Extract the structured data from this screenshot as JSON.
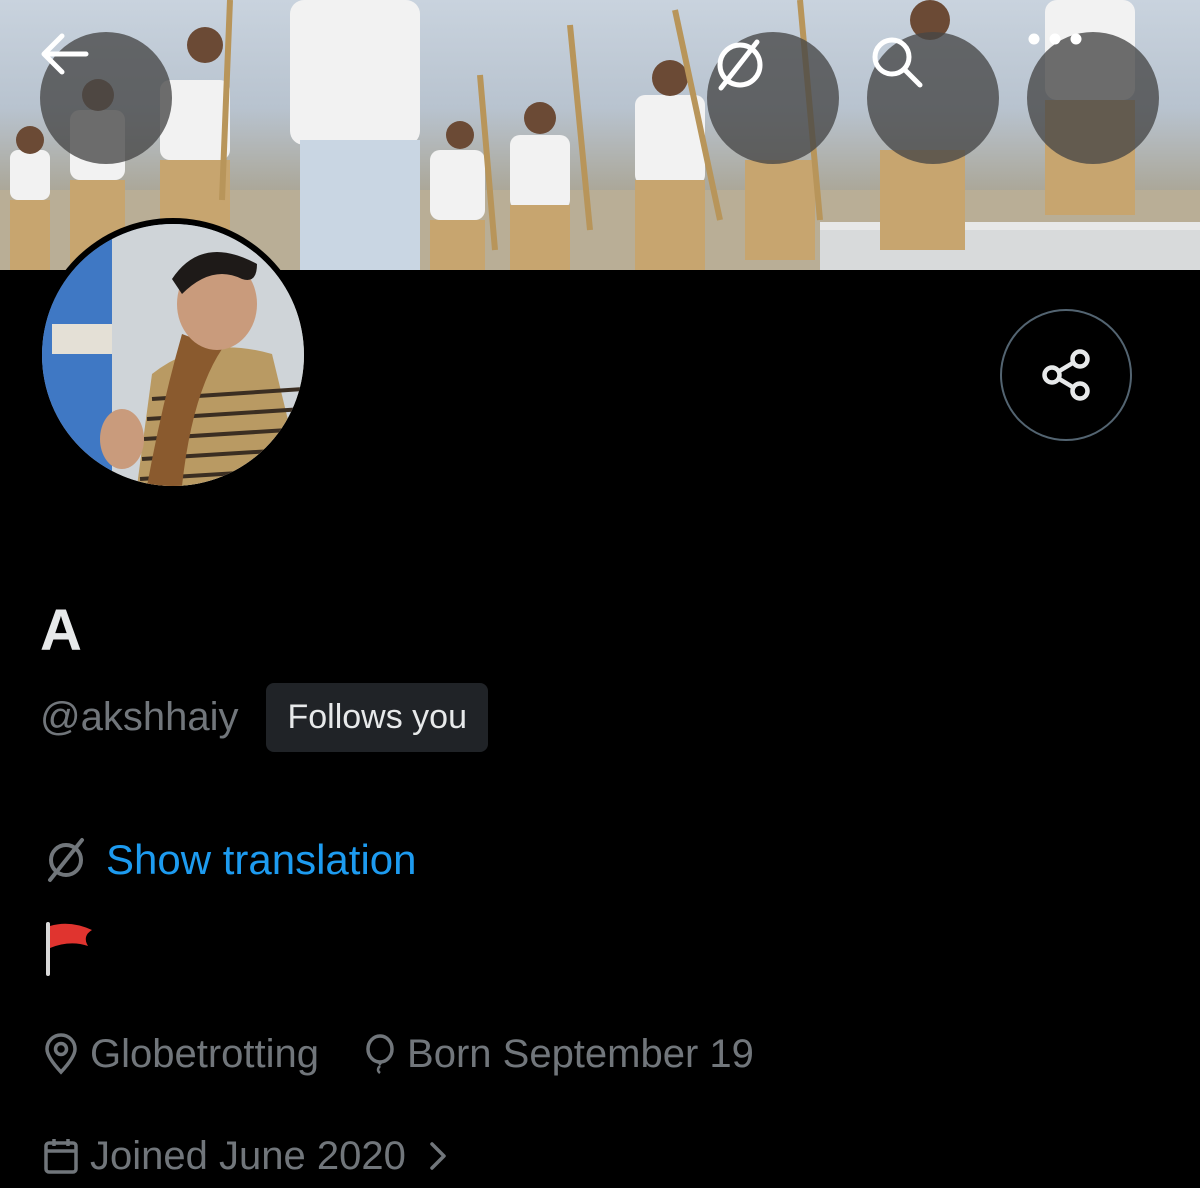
{
  "header": {
    "back_icon": "arrow-left-icon",
    "translate_icon": "translate-icon",
    "search_icon": "search-icon",
    "more_icon": "more-horizontal-icon"
  },
  "profile": {
    "display_name": "A",
    "handle": "@akshhaiy",
    "follows_you_badge": "Follows you",
    "show_translation": "Show translation",
    "bio_icon": "red-flag-emoji",
    "location": "Globetrotting",
    "birthday": "Born September 19",
    "joined": "Joined June 2020"
  },
  "actions": {
    "share_icon": "share-icon"
  },
  "colors": {
    "background": "#000000",
    "link": "#1d9bf0",
    "muted": "#71767b",
    "badge_bg": "#202327"
  }
}
